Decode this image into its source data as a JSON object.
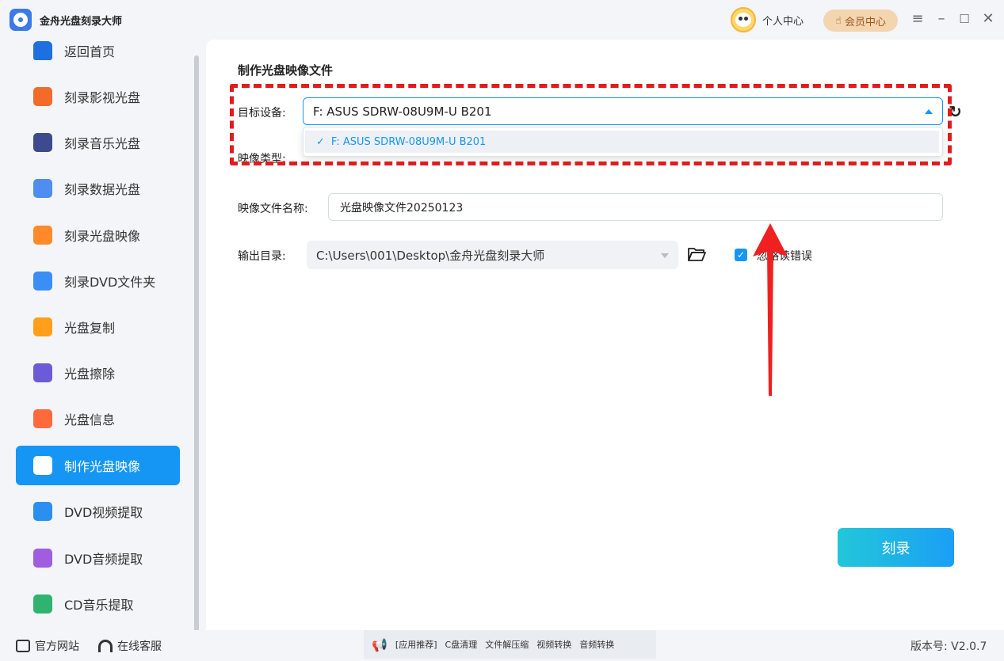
{
  "app": {
    "title": "金舟光盘刻录大师"
  },
  "header": {
    "personal_center": "个人中心",
    "vip_center": "会员中心"
  },
  "sidebar": {
    "items": [
      {
        "label": "返回首页",
        "color": "#1e6fe0"
      },
      {
        "label": "刻录影视光盘",
        "color": "#f36b2b"
      },
      {
        "label": "刻录音乐光盘",
        "color": "#3d4a8f"
      },
      {
        "label": "刻录数据光盘",
        "color": "#4f8ef0"
      },
      {
        "label": "刻录光盘映像",
        "color": "#ff8a2a"
      },
      {
        "label": "刻录DVD文件夹",
        "color": "#3b8ef5"
      },
      {
        "label": "光盘复制",
        "color": "#ff9f1c"
      },
      {
        "label": "光盘擦除",
        "color": "#6b5bd6"
      },
      {
        "label": "光盘信息",
        "color": "#ff6a3d"
      },
      {
        "label": "制作光盘映像",
        "color": "#ffffff",
        "active": true
      },
      {
        "label": "DVD视频提取",
        "color": "#2b8ff0"
      },
      {
        "label": "DVD音频提取",
        "color": "#a15de0"
      },
      {
        "label": "CD音乐提取",
        "color": "#2fb36f"
      }
    ]
  },
  "main": {
    "title": "制作光盘映像文件",
    "target_device_label": "目标设备:",
    "target_device_value": "F: ASUS SDRW-08U9M-U B201",
    "dropdown_options": [
      "F: ASUS SDRW-08U9M-U B201"
    ],
    "image_type_label": "映像类型:",
    "image_name_label": "映像文件名称:",
    "image_name_value": "光盘映像文件20250123",
    "output_dir_label": "输出目录:",
    "output_dir_value": "C:\\Users\\001\\Desktop\\金舟光盘刻录大师",
    "ignore_errors_label": "忽略读错误",
    "ignore_errors_checked": true,
    "burn_button": "刻录"
  },
  "footer": {
    "website": "官方网站",
    "support": "在线客服",
    "promo": [
      "[应用推荐]",
      "C盘清理",
      "文件解压缩",
      "视频转换",
      "音频转换"
    ],
    "version": "版本号: V2.0.7"
  }
}
